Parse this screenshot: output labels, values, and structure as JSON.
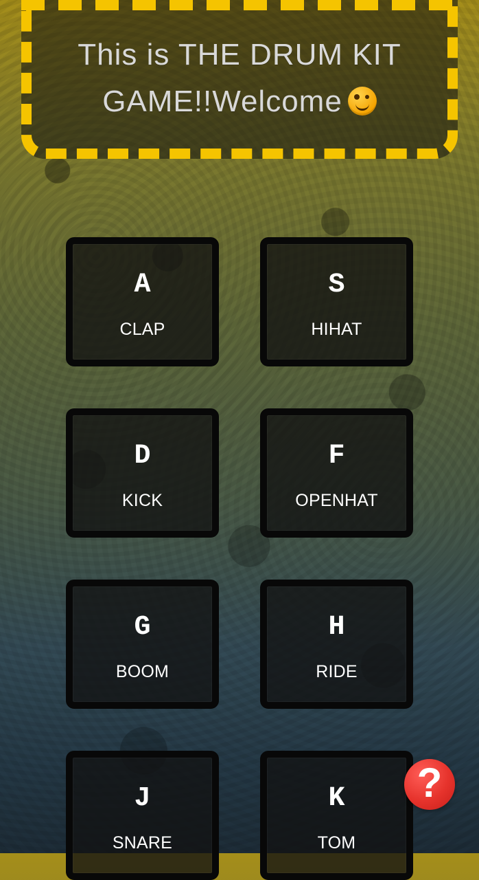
{
  "header": {
    "title": "This is THE DRUM KIT GAME!!Welcome",
    "emoji": "winking-face"
  },
  "pads": [
    {
      "key": "A",
      "sound": "CLAP"
    },
    {
      "key": "S",
      "sound": "HIHAT"
    },
    {
      "key": "D",
      "sound": "KICK"
    },
    {
      "key": "F",
      "sound": "OPENHAT"
    },
    {
      "key": "G",
      "sound": "BOOM"
    },
    {
      "key": "H",
      "sound": "RIDE"
    },
    {
      "key": "J",
      "sound": "SNARE"
    },
    {
      "key": "K",
      "sound": "TOM"
    }
  ],
  "help": {
    "icon": "question-mark",
    "label": "?"
  },
  "colors": {
    "accent": "#f5c400",
    "pad_border": "#080808",
    "help_button": "#e6332c"
  }
}
